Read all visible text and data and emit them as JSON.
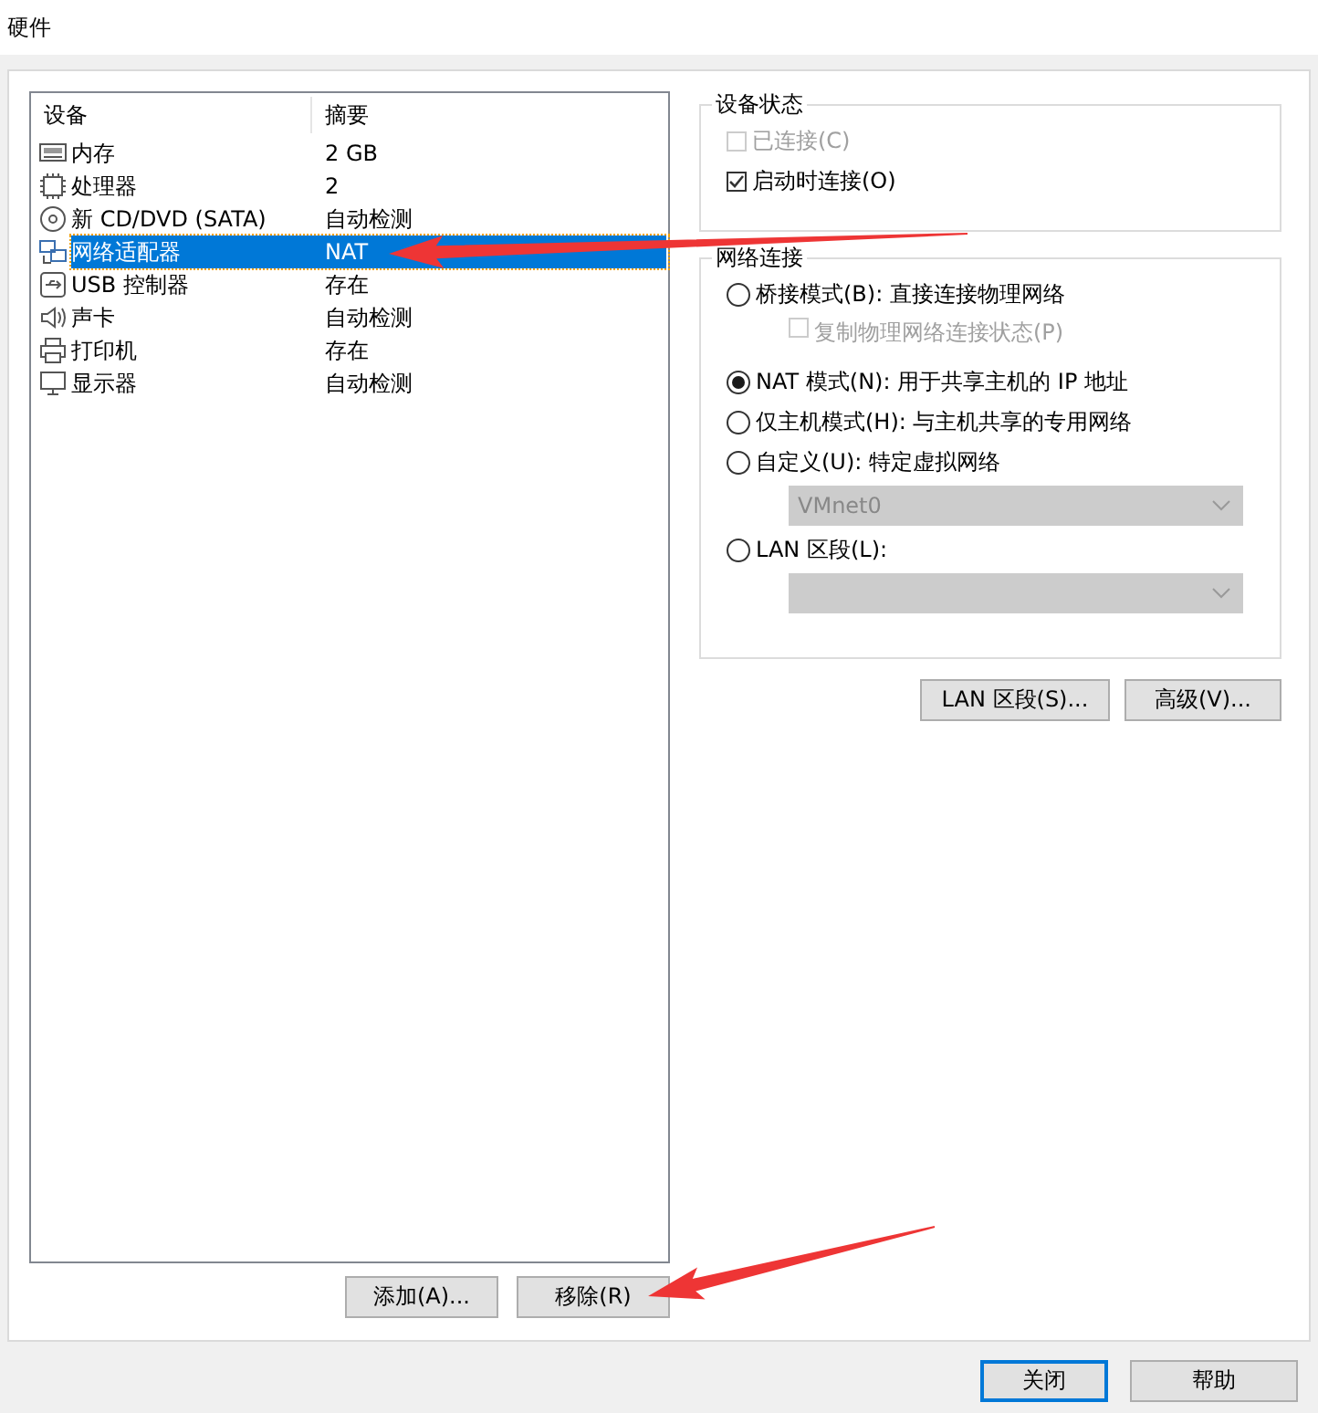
{
  "window": {
    "title": "硬件"
  },
  "device_list": {
    "columns": [
      "设备",
      "摘要"
    ],
    "rows": [
      {
        "kind": "memory",
        "device": "内存",
        "summary": "2 GB",
        "selected": false
      },
      {
        "kind": "cpu",
        "device": "处理器",
        "summary": "2",
        "selected": false
      },
      {
        "kind": "disc",
        "device": "新 CD/DVD (SATA)",
        "summary": "自动检测",
        "selected": false
      },
      {
        "kind": "network",
        "device": "网络适配器",
        "summary": "NAT",
        "selected": true
      },
      {
        "kind": "usb",
        "device": "USB 控制器",
        "summary": "存在",
        "selected": false
      },
      {
        "kind": "sound",
        "device": "声卡",
        "summary": "自动检测",
        "selected": false
      },
      {
        "kind": "printer",
        "device": "打印机",
        "summary": "存在",
        "selected": false
      },
      {
        "kind": "display",
        "device": "显示器",
        "summary": "自动检测",
        "selected": false
      }
    ]
  },
  "device_status": {
    "title": "设备状态",
    "options": [
      {
        "label": "已连接(C)",
        "checked": false,
        "disabled": true
      },
      {
        "label": "启动时连接(O)",
        "checked": true,
        "disabled": false
      }
    ]
  },
  "network_connection": {
    "title": "网络连接",
    "options": [
      {
        "kind": "radio",
        "label": "桥接模式(B): 直接连接物理网络",
        "selected": false
      },
      {
        "kind": "checkbox",
        "label": "复制物理网络连接状态(P)",
        "checked": false,
        "disabled": true
      },
      {
        "kind": "radio",
        "label": "NAT 模式(N): 用于共享主机的 IP 地址",
        "selected": true
      },
      {
        "kind": "radio",
        "label": "仅主机模式(H): 与主机共享的专用网络",
        "selected": false
      },
      {
        "kind": "radio",
        "label": "自定义(U): 特定虚拟网络",
        "selected": false
      },
      {
        "kind": "dropdown",
        "value": "VMnet0",
        "disabled": true
      },
      {
        "kind": "radio",
        "label": "LAN 区段(L):",
        "selected": false
      },
      {
        "kind": "dropdown",
        "disabled": true
      }
    ]
  },
  "network_buttons": [
    "LAN 区段(S)...",
    "高级(V)..."
  ],
  "list_buttons": [
    "添加(A)...",
    "移除(R)"
  ],
  "dialog_buttons": [
    {
      "label": "关闭",
      "default": true
    },
    {
      "label": "帮助",
      "default": false
    }
  ],
  "annotations": [
    {
      "kind": "arrow"
    },
    {
      "kind": "arrow"
    }
  ]
}
